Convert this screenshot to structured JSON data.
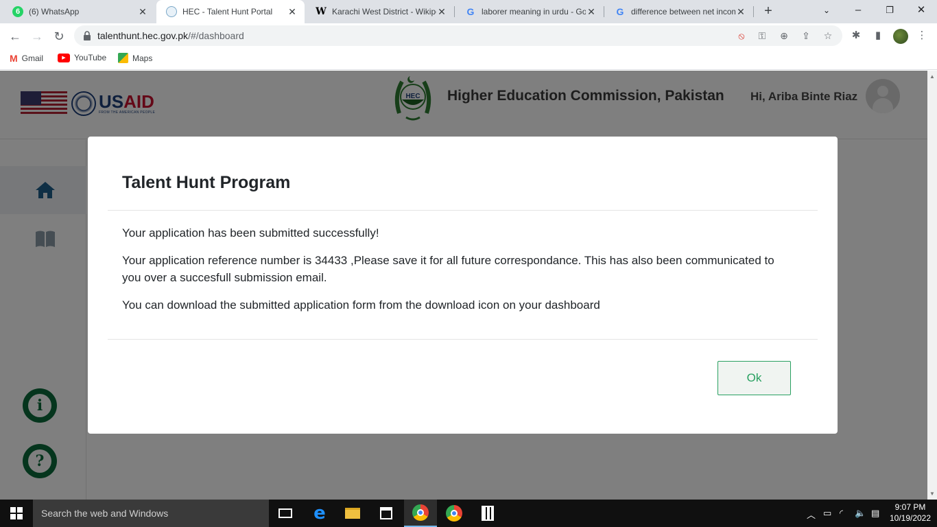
{
  "browser": {
    "tabs": [
      {
        "title": "(6) WhatsApp",
        "favicon": "whatsapp-icon"
      },
      {
        "title": "HEC - Talent Hunt Portal",
        "favicon": "hec-icon",
        "active": true
      },
      {
        "title": "Karachi West District - Wikipe",
        "favicon": "wikipedia-icon"
      },
      {
        "title": "laborer meaning in urdu - Go",
        "favicon": "google-icon"
      },
      {
        "title": "difference between net incom",
        "favicon": "google-icon"
      }
    ],
    "whatsapp_badge": "6",
    "new_tab": "+",
    "url_host": "talenthunt.hec.gov.pk",
    "url_path": "/#/dashboard",
    "bookmarks": [
      {
        "label": "Gmail"
      },
      {
        "label": "YouTube"
      },
      {
        "label": "Maps"
      }
    ]
  },
  "header": {
    "usaid_text_us": "US",
    "usaid_text_aid": "AID",
    "usaid_tagline": "FROM THE AMERICAN PEOPLE",
    "hec_emblem_text": "HEC",
    "org_title": "Higher Education Commission, Pakistan",
    "greeting": "Hi, Ariba Binte Riaz"
  },
  "sidebar": {
    "info_symbol": "i",
    "help_symbol": "?"
  },
  "modal": {
    "title": "Talent Hunt Program",
    "line1": "Your application has been submitted successfully!",
    "line2": "Your application reference number is 34433 ,Please save it for all future correspondance. This has also been communicated to you over a succesfull submission email.",
    "line3": "You can download the submitted application form from the download icon on your dashboard",
    "ok_label": "Ok"
  },
  "taskbar": {
    "search_placeholder": "Search the web and Windows",
    "time": "9:07 PM",
    "date": "10/19/2022"
  },
  "colors": {
    "hec_green": "#0b6b3a",
    "ok_green": "#28a060",
    "backdrop": "rgba(0,0,0,0.5)"
  }
}
